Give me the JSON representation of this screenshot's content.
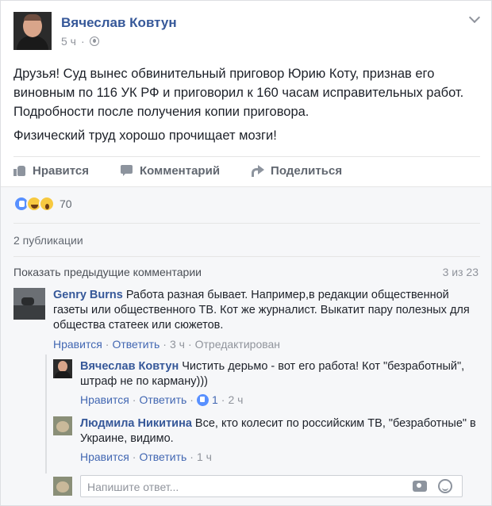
{
  "post": {
    "author": "Вячеслав Ковтун",
    "time": "5 ч",
    "paragraphs": [
      "Друзья! Суд вынес обвинительный приговор Юрию Коту, признав его виновным по 116 УК РФ и приговорил к 160 часам исправительных работ. Подробности после получения копии приговора.",
      "Физический труд хорошо прочищает мозги!"
    ]
  },
  "actions": {
    "like": "Нравится",
    "comment": "Комментарий",
    "share": "Поделиться"
  },
  "reactions": {
    "count": "70",
    "types": [
      "like-icon",
      "haha-icon",
      "wow-icon"
    ]
  },
  "shares": "2 публикации",
  "comments_header": {
    "show_previous": "Показать предыдущие комментарии",
    "counter": "3 из 23"
  },
  "comments": [
    {
      "author": "Genry Burns",
      "text": "Работа разная бывает. Например,в редакции общественной газеты или общественного ТВ. Кот же журналист. Выкатит пару полезных для общества статеек или сюжетов.",
      "like": "Нравится",
      "reply": "Ответить",
      "time": "3 ч",
      "edited": "Отредактирован"
    }
  ],
  "replies": [
    {
      "author": "Вячеслав Ковтун",
      "text": "Чистить дерьмо - вот его работа! Кот \"безработный\", штраф не по карману)))",
      "like": "Нравится",
      "reply": "Ответить",
      "likes": "1",
      "time": "2 ч"
    },
    {
      "author": "Людмила Никитина",
      "text": "Все, кто колесит по российским ТВ, \"безработные\" в Украине, видимо.",
      "like": "Нравится",
      "reply": "Ответить",
      "time": "1 ч"
    }
  ],
  "reply_box": {
    "placeholder": "Напишите ответ..."
  },
  "separator": "·"
}
